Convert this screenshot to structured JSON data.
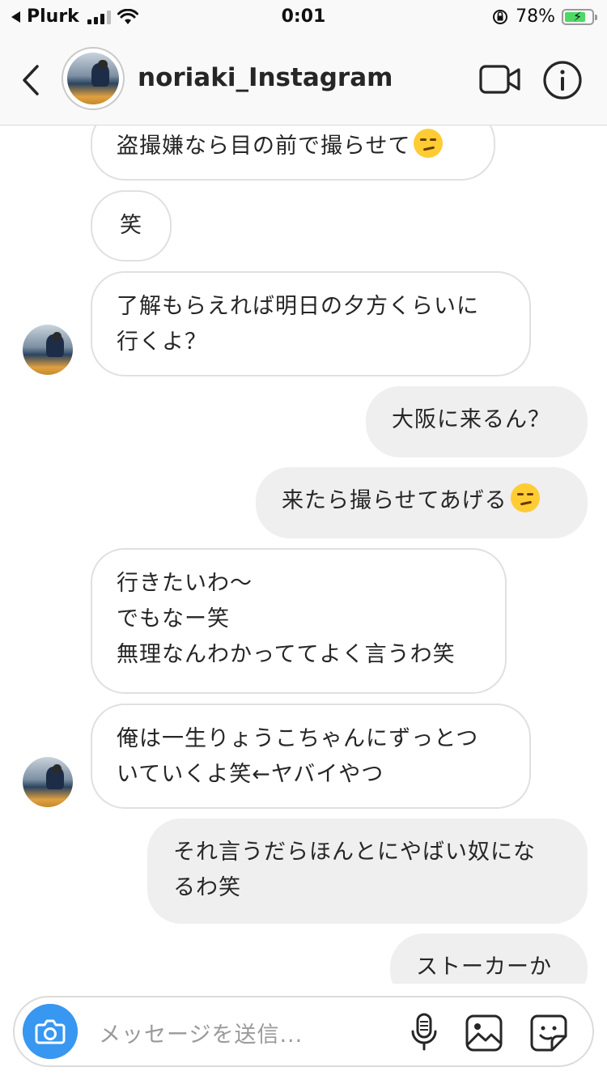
{
  "status_bar": {
    "carrier": "Plurk",
    "time": "0:01",
    "battery_percent": "78%",
    "battery_level": 0.78,
    "signal_bars": 3
  },
  "header": {
    "username": "noriaki_Instagram",
    "back_icon": "chevron-left-icon",
    "video_icon": "video-camera-icon",
    "info_icon": "info-icon"
  },
  "messages": [
    {
      "side": "in",
      "text": "盗撮嫌なら目の前で撮らせて",
      "emoji": "smirk"
    },
    {
      "side": "in",
      "text": "笑"
    },
    {
      "side": "in",
      "text": "了解もらえれば明日の夕方くらいに\n行くよ？"
    },
    {
      "side": "out",
      "text": "大阪に来るん？"
    },
    {
      "side": "out",
      "text": "来たら撮らせてあげる",
      "emoji": "smirk"
    },
    {
      "side": "in",
      "text": "行きたいわ〜\nでもなー笑\n無理なんわかっててよく言うわ笑"
    },
    {
      "side": "in",
      "text": "俺は一生りょうこちゃんにずっとつ\nいていくよ笑←ヤバイやつ"
    },
    {
      "side": "out",
      "text": "それ言うだらほんとにやばい奴にな\nるわ笑"
    },
    {
      "side": "out",
      "text": "ストーカーか"
    }
  ],
  "composer": {
    "placeholder": "メッセージを送信...",
    "camera_icon": "camera-icon",
    "mic_icon": "microphone-icon",
    "gallery_icon": "image-gallery-icon",
    "sticker_icon": "sticker-icon"
  },
  "colors": {
    "accent": "#3897f0",
    "outgoing_bubble": "#efefef",
    "incoming_border": "#e0e0e0",
    "battery": "#4cd964"
  }
}
